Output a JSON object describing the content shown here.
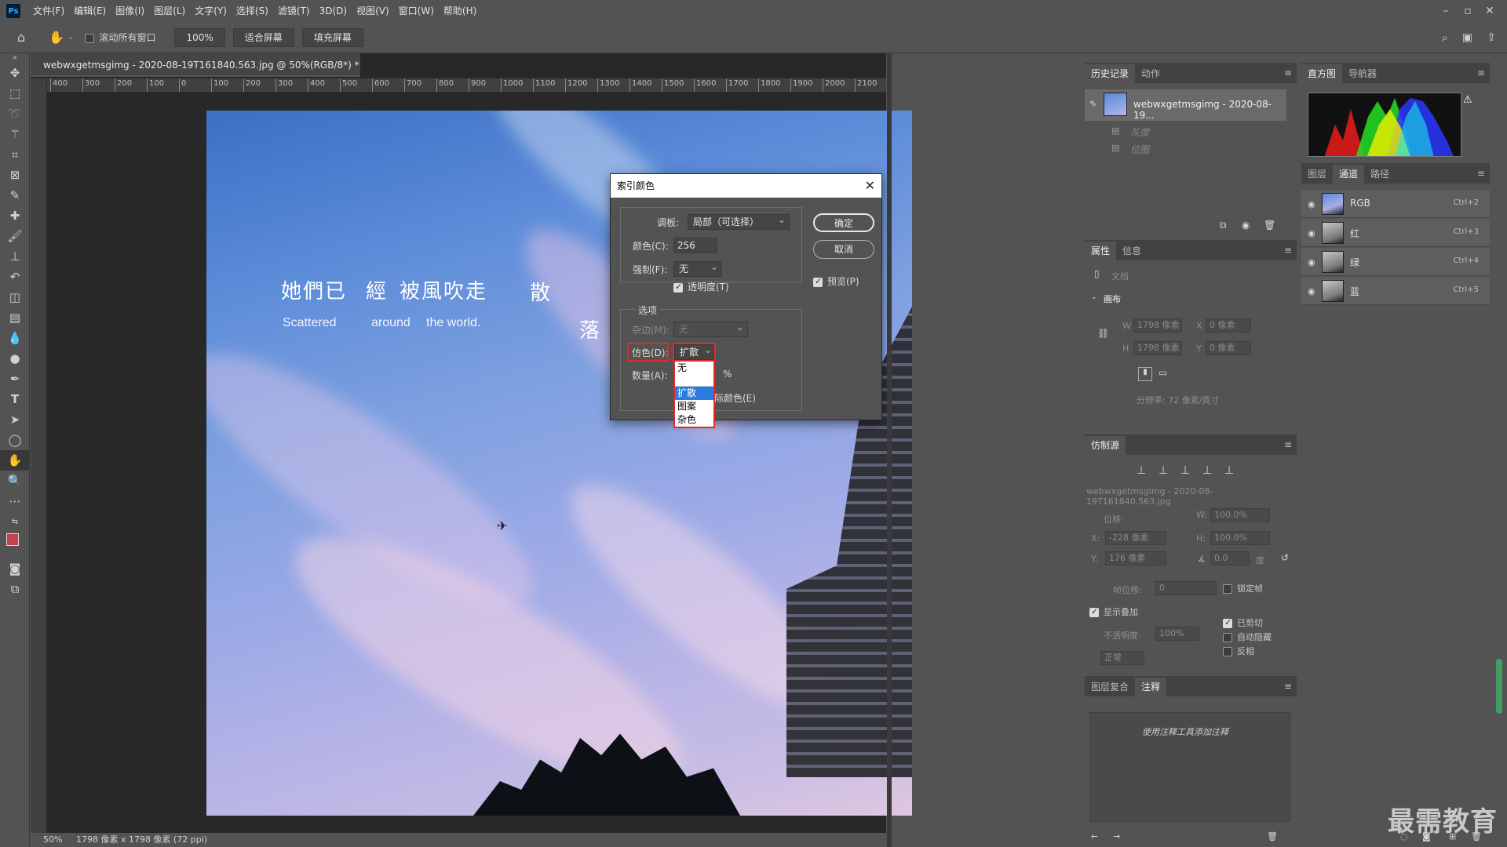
{
  "menubar": {
    "logo": "Ps",
    "items": [
      "文件(F)",
      "编辑(E)",
      "图像(I)",
      "图层(L)",
      "文字(Y)",
      "选择(S)",
      "滤镜(T)",
      "3D(D)",
      "视图(V)",
      "窗口(W)",
      "帮助(H)"
    ]
  },
  "options_bar": {
    "scroll_all_label": "滚动所有窗口",
    "zoom_value": "100%",
    "fit_screen": "适合屏幕",
    "fill_screen": "填充屏幕"
  },
  "document": {
    "tab_title": "webwxgetmsgimg - 2020-08-19T161840.563.jpg @ 50%(RGB/8*) *",
    "tab_close": "×",
    "ruler_ticks": [
      "400",
      "300",
      "200",
      "100",
      "0",
      "100",
      "200",
      "300",
      "400",
      "500",
      "600",
      "700",
      "800",
      "900",
      "1000",
      "1100",
      "1200",
      "1300",
      "1400",
      "1500",
      "1600",
      "1700",
      "1800",
      "1900",
      "2000",
      "2100"
    ],
    "status_zoom": "50%",
    "status_info": "1798 像素 x 1798 像素 (72 ppi)"
  },
  "canvas_text": {
    "cn_line1": "她們已",
    "cn_line2": "經",
    "cn_line3": "被風吹走",
    "cn_scatter": "散",
    "cn_fall": "落",
    "en_line1": "Scattered",
    "en_line2": "around",
    "en_line3": "the world."
  },
  "dialog": {
    "title": "索引颜色",
    "close": "✕",
    "palette_label": "调板:",
    "palette_value": "局部（可选择）",
    "colors_label": "颜色(C):",
    "colors_value": "256",
    "forced_label": "强制(F):",
    "forced_value": "无",
    "transparency_label": "透明度(T)",
    "options_title": "选项",
    "matte_label": "杂边(M):",
    "matte_value": "无",
    "dither_label": "仿色(D):",
    "dither_value": "扩散",
    "amount_label": "数量(A):",
    "amount_unit": "%",
    "preserve_label": "际颜色(E)",
    "ok": "确定",
    "cancel": "取消",
    "preview": "预览(P)",
    "dither_options": [
      "无",
      "扩散",
      "图案",
      "杂色"
    ]
  },
  "history_panel": {
    "tabs": [
      "历史记录",
      "动作"
    ],
    "snapshot": "webwxgetmsgimg - 2020-08-19...",
    "steps": [
      "灰度",
      "位图"
    ]
  },
  "histogram_panel": {
    "tabs": [
      "直方图",
      "导航器"
    ]
  },
  "channels_panel": {
    "tabs": [
      "图层",
      "通道",
      "路径"
    ],
    "channels": [
      {
        "name": "RGB",
        "key": "Ctrl+2"
      },
      {
        "name": "红",
        "key": "Ctrl+3"
      },
      {
        "name": "绿",
        "key": "Ctrl+4"
      },
      {
        "name": "蓝",
        "key": "Ctrl+5"
      }
    ]
  },
  "properties_panel": {
    "tabs": [
      "属性",
      "信息"
    ],
    "doc_label": "文档",
    "canvas_label": "画布",
    "w_label": "W",
    "h_label": "H",
    "x_label": "X",
    "y_label": "Y",
    "w_value": "1798 像素",
    "h_value": "1798 像素",
    "x_value": "0 像素",
    "y_value": "0 像素",
    "resolution": "分辨率: 72 像素/英寸"
  },
  "clone_panel": {
    "tab": "仿制源",
    "file": "webwxgetmsgimg - 2020-08-19T161840.563.jpg",
    "offset_label": "位移:",
    "w_label": "W:",
    "w_value": "100.0%",
    "h_label": "H:",
    "h_value": "100.0%",
    "x_label": "X:",
    "x_value": "-228 像素",
    "y_label": "Y:",
    "y_value": "176 像素",
    "angle_value": "0.0",
    "angle_unit": "度",
    "frame_offset_label": "帧位移:",
    "frame_offset_value": "0",
    "lock_frame": "锁定帧",
    "show_overlay": "显示叠加",
    "opacity_label": "不透明度:",
    "opacity_value": "100%",
    "clipped": "已剪切",
    "auto_hide": "自动隐藏",
    "invert": "反相",
    "blend_mode": "正常"
  },
  "notes_panel": {
    "tabs": [
      "图层复合",
      "注释"
    ],
    "hint": "使用注释工具添加注释"
  },
  "watermark": "最需教育",
  "colors": {
    "bg": "#535353",
    "dark": "#282828",
    "highlight_red": "#e22828",
    "selection_blue": "#2a7ce0"
  }
}
